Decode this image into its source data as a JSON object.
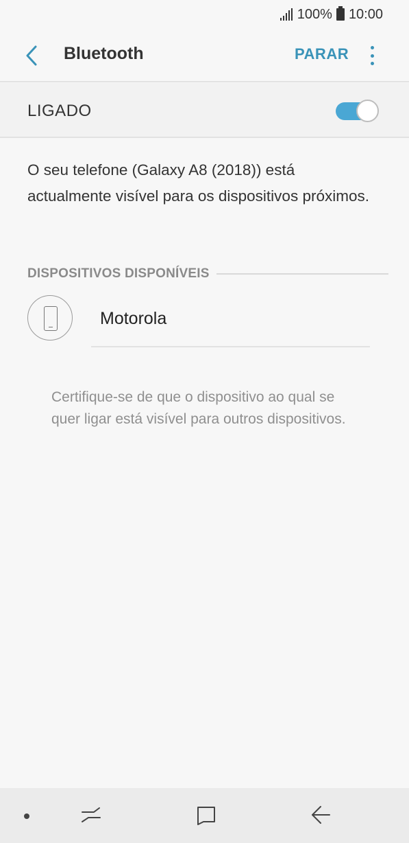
{
  "status_bar": {
    "signal_icon": "signal-bars-icon",
    "battery_percent": "100%",
    "battery_icon": "battery-icon",
    "time": "10:00"
  },
  "app_bar": {
    "back_icon": "chevron-left-icon",
    "title": "Bluetooth",
    "stop_label": "PARAR",
    "more_icon": "more-vertical-icon"
  },
  "toggle": {
    "label": "LIGADO",
    "state": "on",
    "accent_color": "#4aa7d4"
  },
  "description": "O seu telefone (Galaxy A8 (2018)) está actualmente visível para os dispositivos próximos.",
  "available_devices": {
    "header": "DISPOSITIVOS DISPONÍVEIS",
    "items": [
      {
        "name": "Motorola",
        "icon": "phone-icon"
      }
    ]
  },
  "hint": "Certifique-se de que o dispositivo ao qual se quer ligar está visível para outros dispositivos.",
  "nav_bar": {
    "dot_icon": "dot-icon",
    "recent_icon": "recent-apps-icon",
    "home_icon": "home-icon",
    "back_icon": "back-arrow-icon"
  }
}
